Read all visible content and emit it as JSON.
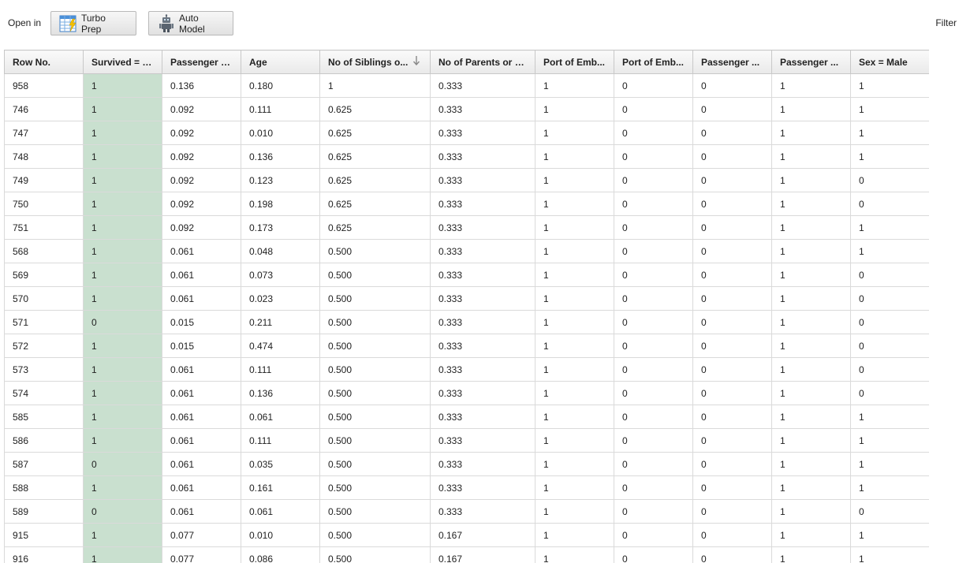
{
  "toolbar": {
    "open_in_label": "Open in",
    "turbo_prep_label": "Turbo Prep",
    "auto_model_label": "Auto Model",
    "filter_label": "Filter"
  },
  "colors": {
    "highlight_column": "#c9e0cf",
    "header_bg": "#ececec",
    "grid_line": "#dadada"
  },
  "table": {
    "columns": [
      "Row No.",
      "Survived = No",
      "Passenger F...",
      "Age",
      "No of Siblings o...",
      "No of Parents or C...",
      "Port of Emb...",
      "Port of Emb...",
      "Passenger ...",
      "Passenger ...",
      "Sex = Male"
    ],
    "sort_icon": "arrow-down-icon",
    "rows": [
      [
        "958",
        "1",
        "0.136",
        "0.180",
        "1",
        "0.333",
        "1",
        "0",
        "0",
        "1",
        "1"
      ],
      [
        "746",
        "1",
        "0.092",
        "0.111",
        "0.625",
        "0.333",
        "1",
        "0",
        "0",
        "1",
        "1"
      ],
      [
        "747",
        "1",
        "0.092",
        "0.010",
        "0.625",
        "0.333",
        "1",
        "0",
        "0",
        "1",
        "1"
      ],
      [
        "748",
        "1",
        "0.092",
        "0.136",
        "0.625",
        "0.333",
        "1",
        "0",
        "0",
        "1",
        "1"
      ],
      [
        "749",
        "1",
        "0.092",
        "0.123",
        "0.625",
        "0.333",
        "1",
        "0",
        "0",
        "1",
        "0"
      ],
      [
        "750",
        "1",
        "0.092",
        "0.198",
        "0.625",
        "0.333",
        "1",
        "0",
        "0",
        "1",
        "0"
      ],
      [
        "751",
        "1",
        "0.092",
        "0.173",
        "0.625",
        "0.333",
        "1",
        "0",
        "0",
        "1",
        "1"
      ],
      [
        "568",
        "1",
        "0.061",
        "0.048",
        "0.500",
        "0.333",
        "1",
        "0",
        "0",
        "1",
        "1"
      ],
      [
        "569",
        "1",
        "0.061",
        "0.073",
        "0.500",
        "0.333",
        "1",
        "0",
        "0",
        "1",
        "0"
      ],
      [
        "570",
        "1",
        "0.061",
        "0.023",
        "0.500",
        "0.333",
        "1",
        "0",
        "0",
        "1",
        "0"
      ],
      [
        "571",
        "0",
        "0.015",
        "0.211",
        "0.500",
        "0.333",
        "1",
        "0",
        "0",
        "1",
        "0"
      ],
      [
        "572",
        "1",
        "0.015",
        "0.474",
        "0.500",
        "0.333",
        "1",
        "0",
        "0",
        "1",
        "0"
      ],
      [
        "573",
        "1",
        "0.061",
        "0.111",
        "0.500",
        "0.333",
        "1",
        "0",
        "0",
        "1",
        "0"
      ],
      [
        "574",
        "1",
        "0.061",
        "0.136",
        "0.500",
        "0.333",
        "1",
        "0",
        "0",
        "1",
        "0"
      ],
      [
        "585",
        "1",
        "0.061",
        "0.061",
        "0.500",
        "0.333",
        "1",
        "0",
        "0",
        "1",
        "1"
      ],
      [
        "586",
        "1",
        "0.061",
        "0.111",
        "0.500",
        "0.333",
        "1",
        "0",
        "0",
        "1",
        "1"
      ],
      [
        "587",
        "0",
        "0.061",
        "0.035",
        "0.500",
        "0.333",
        "1",
        "0",
        "0",
        "1",
        "1"
      ],
      [
        "588",
        "1",
        "0.061",
        "0.161",
        "0.500",
        "0.333",
        "1",
        "0",
        "0",
        "1",
        "1"
      ],
      [
        "589",
        "0",
        "0.061",
        "0.061",
        "0.500",
        "0.333",
        "1",
        "0",
        "0",
        "1",
        "0"
      ],
      [
        "915",
        "1",
        "0.077",
        "0.010",
        "0.500",
        "0.167",
        "1",
        "0",
        "0",
        "1",
        "1"
      ],
      [
        "916",
        "1",
        "0.077",
        "0.086",
        "0.500",
        "0.167",
        "1",
        "0",
        "0",
        "1",
        "1"
      ]
    ]
  }
}
